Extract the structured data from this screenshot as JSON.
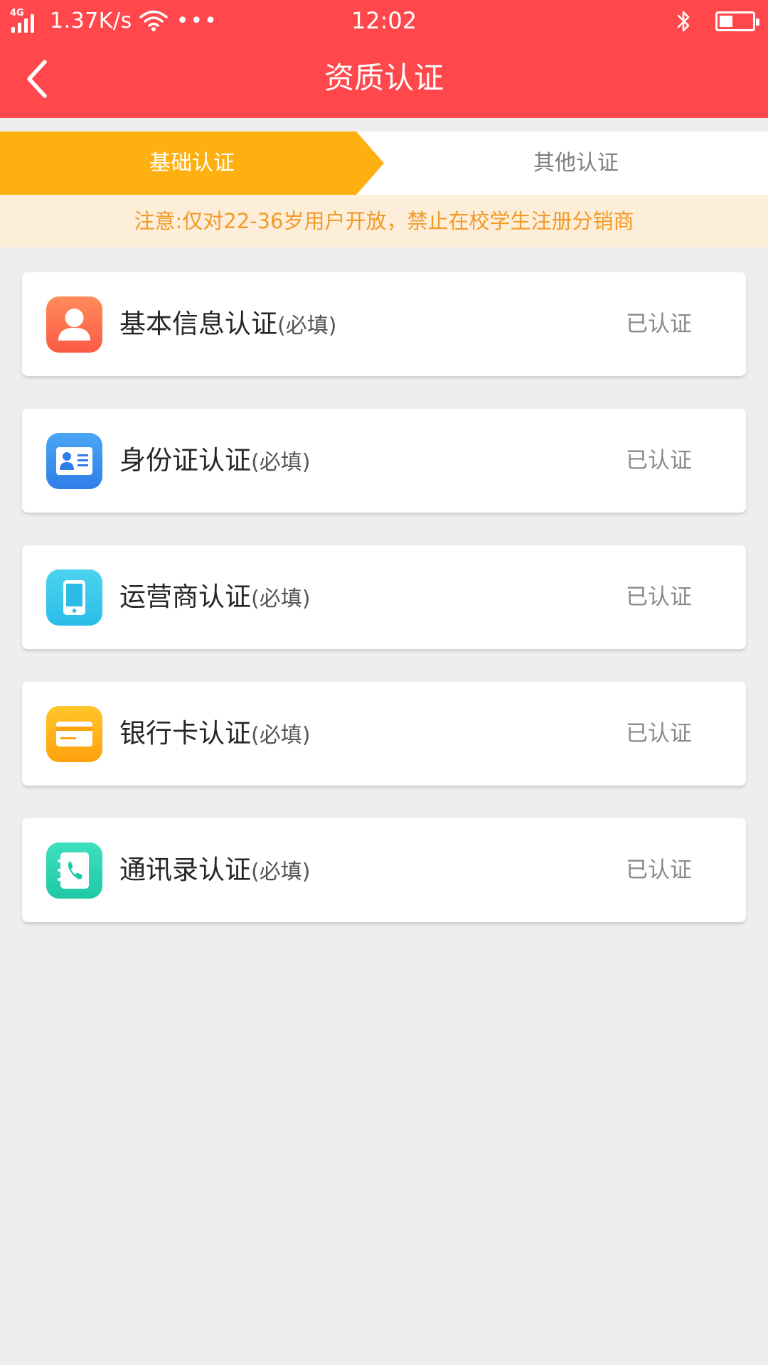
{
  "status_bar": {
    "network": "4G",
    "speed": "1.37K/s",
    "more": "•••",
    "time": "12:02",
    "battery_level": 0.4
  },
  "nav": {
    "title": "资质认证",
    "back_icon": "chevron-left-icon"
  },
  "tabs": [
    {
      "label": "基础认证",
      "active": true
    },
    {
      "label": "其他认证",
      "active": false
    }
  ],
  "notice": "注意:仅对22-36岁用户开放，禁止在校学生注册分销商",
  "items": [
    {
      "title": "基本信息认证",
      "required": "(必填)",
      "status": "已认证",
      "icon": "user-icon"
    },
    {
      "title": "身份证认证",
      "required": "(必填)",
      "status": "已认证",
      "icon": "id-card-icon"
    },
    {
      "title": "运营商认证",
      "required": "(必填)",
      "status": "已认证",
      "icon": "phone-icon"
    },
    {
      "title": "银行卡认证",
      "required": "(必填)",
      "status": "已认证",
      "icon": "bank-card-icon"
    },
    {
      "title": "通讯录认证",
      "required": "(必填)",
      "status": "已认证",
      "icon": "contacts-icon"
    }
  ],
  "colors": {
    "header": "#ff474c",
    "tab_active": "#fdb010",
    "notice_bg": "#fdeed9",
    "notice_text": "#f29a27",
    "page_bg": "#eeeeee"
  }
}
